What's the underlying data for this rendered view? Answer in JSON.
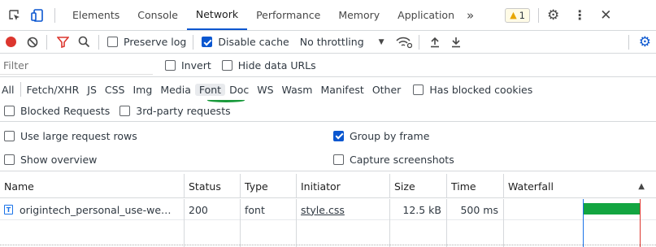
{
  "tabs": [
    "Elements",
    "Console",
    "Network",
    "Performance",
    "Memory",
    "Application"
  ],
  "active_tab": "Network",
  "more_tabs": "»",
  "warning_count": "1",
  "toolbar": {
    "preserve_log": "Preserve log",
    "disable_cache": "Disable cache",
    "throttling": "No throttling",
    "preserve_log_checked": false,
    "disable_cache_checked": true
  },
  "filter": {
    "placeholder": "Filter",
    "invert": "Invert",
    "hide_data_urls": "Hide data URLs"
  },
  "types": [
    "All",
    "Fetch/XHR",
    "JS",
    "CSS",
    "Img",
    "Media",
    "Font",
    "Doc",
    "WS",
    "Wasm",
    "Manifest",
    "Other"
  ],
  "active_type": "Font",
  "has_blocked_cookies": "Has blocked cookies",
  "blocked_requests": "Blocked Requests",
  "third_party": "3rd-party requests",
  "options": {
    "large_rows": "Use large request rows",
    "group_by_frame": "Group by frame",
    "show_overview": "Show overview",
    "capture_screenshots": "Capture screenshots",
    "group_by_frame_checked": true
  },
  "columns": [
    "Name",
    "Status",
    "Type",
    "Initiator",
    "Size",
    "Time",
    "Waterfall"
  ],
  "sort_indicator": "▲",
  "rows": [
    {
      "name": "origintech_personal_use-we…",
      "status": "200",
      "type": "font",
      "initiator": "style.css",
      "size": "12.5 kB",
      "time": "500 ms"
    }
  ],
  "colors": {
    "accent": "#0b57d0",
    "record": "#dc362e",
    "waterfall": "#13a541",
    "highlight": "#1a9a3c"
  }
}
